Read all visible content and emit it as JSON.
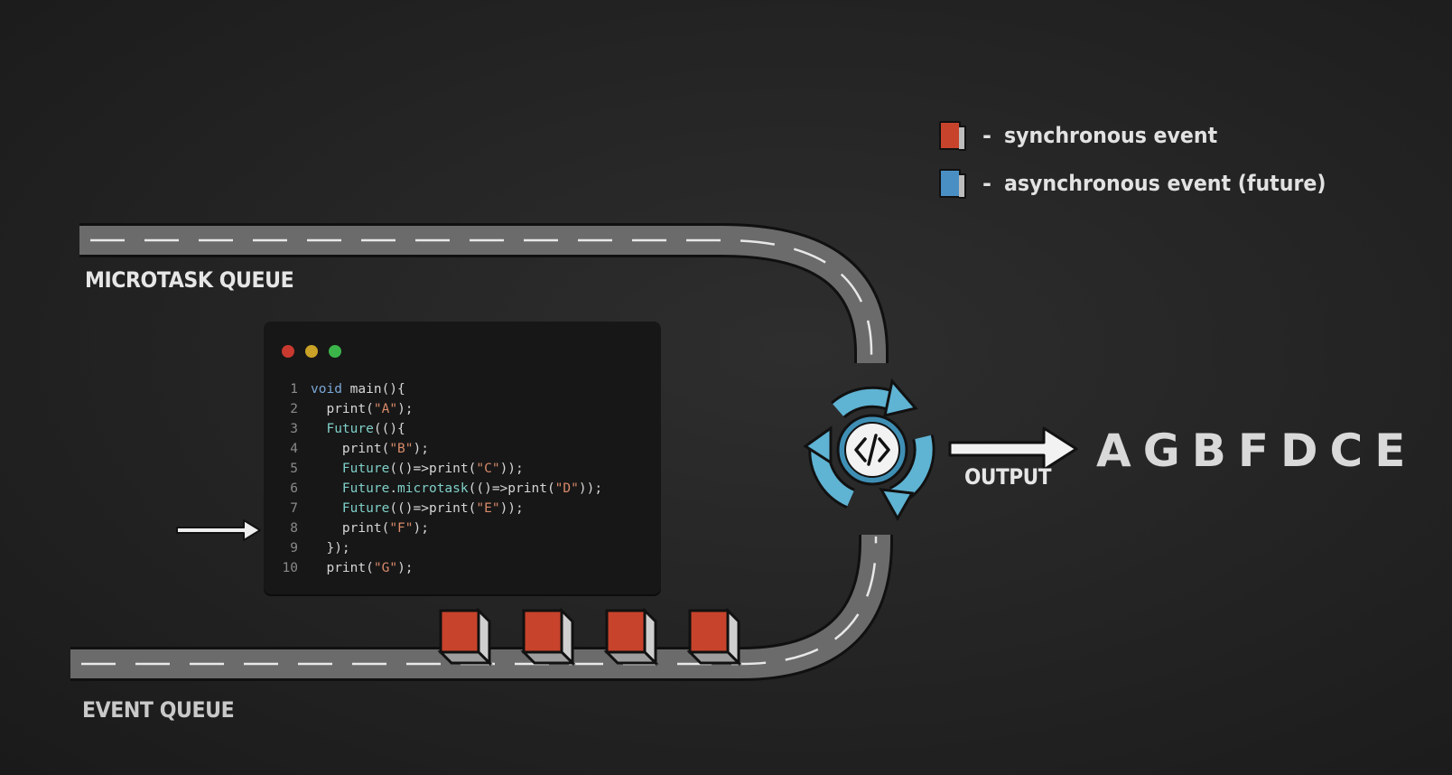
{
  "labels": {
    "microtask_queue": "MICROTASK QUEUE",
    "event_queue": "EVENT QUEUE",
    "output": "OUTPUT"
  },
  "legend": [
    {
      "text": "synchronous event",
      "color": "#c8432c"
    },
    {
      "text": "asynchronous event (future)",
      "color": "#4a8fc4"
    }
  ],
  "legend_dash": "-",
  "code": {
    "lines": [
      {
        "n": "1",
        "tokens": [
          [
            "kw",
            "void"
          ],
          [
            "pun",
            " "
          ],
          [
            "fn",
            "main"
          ],
          [
            "pun",
            "(){"
          ]
        ]
      },
      {
        "n": "2",
        "tokens": [
          [
            "pun",
            "  "
          ],
          [
            "fn",
            "print"
          ],
          [
            "pun",
            "("
          ],
          [
            "str",
            "\"A\""
          ],
          [
            "pun",
            ");"
          ]
        ]
      },
      {
        "n": "3",
        "tokens": [
          [
            "pun",
            "  "
          ],
          [
            "cls",
            "Future"
          ],
          [
            "pun",
            "((){"
          ]
        ]
      },
      {
        "n": "4",
        "tokens": [
          [
            "pun",
            "    "
          ],
          [
            "fn",
            "print"
          ],
          [
            "pun",
            "("
          ],
          [
            "str",
            "\"B\""
          ],
          [
            "pun",
            ");"
          ]
        ]
      },
      {
        "n": "5",
        "tokens": [
          [
            "pun",
            "    "
          ],
          [
            "cls",
            "Future"
          ],
          [
            "pun",
            "(()=>"
          ],
          [
            "fn",
            "print"
          ],
          [
            "pun",
            "("
          ],
          [
            "str",
            "\"C\""
          ],
          [
            "pun",
            "));"
          ]
        ]
      },
      {
        "n": "6",
        "tokens": [
          [
            "pun",
            "    "
          ],
          [
            "cls",
            "Future"
          ],
          [
            "pun",
            "."
          ],
          [
            "cls",
            "microtask"
          ],
          [
            "pun",
            "(()=>"
          ],
          [
            "fn",
            "print"
          ],
          [
            "pun",
            "("
          ],
          [
            "str",
            "\"D\""
          ],
          [
            "pun",
            "));"
          ]
        ]
      },
      {
        "n": "7",
        "tokens": [
          [
            "pun",
            "    "
          ],
          [
            "cls",
            "Future"
          ],
          [
            "pun",
            "(()=>"
          ],
          [
            "fn",
            "print"
          ],
          [
            "pun",
            "("
          ],
          [
            "str",
            "\"E\""
          ],
          [
            "pun",
            "));"
          ]
        ]
      },
      {
        "n": "8",
        "tokens": [
          [
            "pun",
            "    "
          ],
          [
            "fn",
            "print"
          ],
          [
            "pun",
            "("
          ],
          [
            "str",
            "\"F\""
          ],
          [
            "pun",
            ");"
          ]
        ]
      },
      {
        "n": "9",
        "tokens": [
          [
            "pun",
            "  });"
          ]
        ]
      },
      {
        "n": "10",
        "tokens": [
          [
            "pun",
            "  "
          ],
          [
            "fn",
            "print"
          ],
          [
            "pun",
            "("
          ],
          [
            "str",
            "\"G\""
          ],
          [
            "pun",
            ");"
          ]
        ]
      }
    ],
    "current_line": 8
  },
  "event_queue_items": [
    {
      "kind": "synchronous"
    },
    {
      "kind": "synchronous"
    },
    {
      "kind": "synchronous"
    },
    {
      "kind": "synchronous"
    }
  ],
  "output_sequence": "AGBFDCE",
  "colors": {
    "synchronous": "#c8432c",
    "asynchronous": "#4a8fc4",
    "event_loop": "#5fb3d3"
  },
  "icons": {
    "event_loop": "code-cycle-icon",
    "output_arrow": "arrow-right-icon",
    "pointer_arrow": "arrow-right-icon"
  }
}
